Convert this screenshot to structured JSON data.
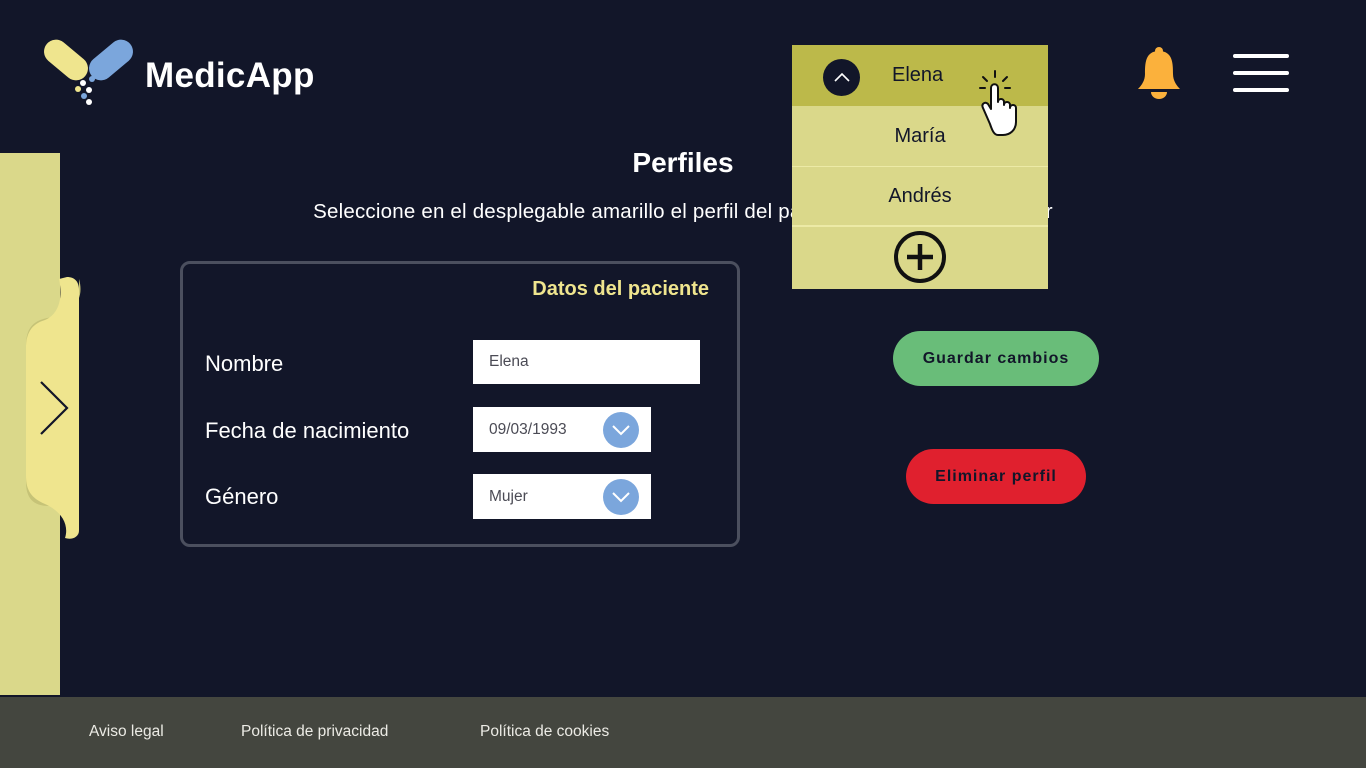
{
  "brand": {
    "name": "MedicApp"
  },
  "header": {
    "bell_icon": "bell-icon",
    "menu_icon": "hamburger-menu-icon"
  },
  "page": {
    "title": "Perfiles",
    "subtitle": "Seleccione en el desplegable amarillo el perfil del paciente que desea gestionar"
  },
  "card": {
    "title": "Datos del paciente",
    "fields": {
      "name": {
        "label": "Nombre",
        "value": "Elena"
      },
      "birthdate": {
        "label": "Fecha de nacimiento",
        "value": "09/03/1993"
      },
      "gender": {
        "label": "Género",
        "value": "Mujer"
      }
    }
  },
  "profile_dropdown": {
    "selected": "Elena",
    "options": [
      "María",
      "Andrés"
    ],
    "add_icon": "plus-circle-icon"
  },
  "actions": {
    "save_label": "Guardar cambios",
    "delete_label": "Eliminar perfil"
  },
  "footer": {
    "links": [
      "Aviso legal",
      "Política de privacidad",
      "Política de cookies"
    ]
  },
  "colors": {
    "background": "#121629",
    "accent_yellow": "#dad88a",
    "selected_yellow": "#bcb94a",
    "save_green": "#69bd79",
    "delete_red": "#e0202e",
    "select_blue": "#7ba6dc",
    "bell_orange": "#fbb13c",
    "footer": "#44463f"
  }
}
